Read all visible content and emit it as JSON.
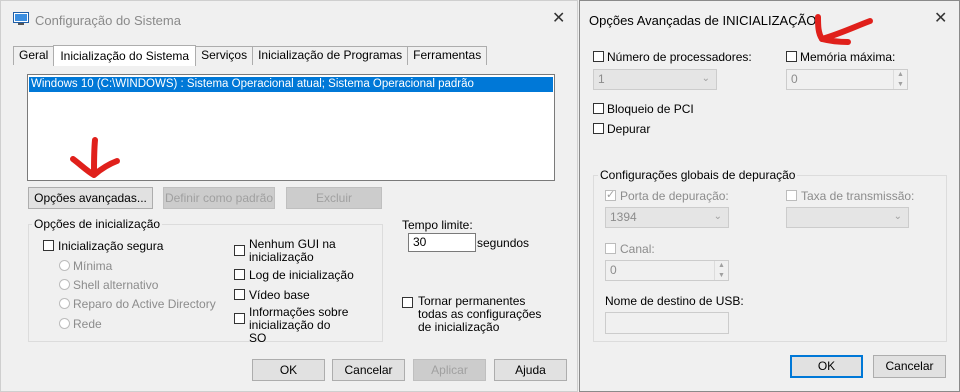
{
  "left_window": {
    "title": "Configuração do Sistema",
    "tabs": [
      "Geral",
      "Inicialização do Sistema",
      "Serviços",
      "Inicialização de Programas",
      "Ferramentas"
    ],
    "os_entries": [
      "Windows 10 (C:\\WINDOWS) : Sistema Operacional atual; Sistema Operacional padrão"
    ],
    "buttons": {
      "advanced": "Opções avançadas...",
      "set_default": "Definir como padrão",
      "delete": "Excluir"
    },
    "boot_options": {
      "label": "Opções de inicialização",
      "safe_boot": "Inicialização segura",
      "minimal": "Mínima",
      "alt_shell": "Shell alternativo",
      "ad_repair": "Reparo do Active Directory",
      "network": "Rede",
      "no_gui": "Nenhum GUI na inicialização",
      "boot_log": "Log de inicialização",
      "base_video": "Vídeo base",
      "os_boot_info": "Informações sobre inicialização do SO"
    },
    "timeout": {
      "label": "Tempo limite:",
      "value": "30",
      "unit": "segundos"
    },
    "make_permanent": "Tornar permanentes todas as configurações de inicialização",
    "footer": {
      "ok": "OK",
      "cancel": "Cancelar",
      "apply": "Aplicar",
      "help": "Ajuda"
    }
  },
  "right_window": {
    "title": "Opções Avançadas de INICIALIZAÇÃO",
    "num_processors": {
      "label": "Número de processadores:",
      "value": "1"
    },
    "max_memory": {
      "label": "Memória máxima:",
      "value": "0"
    },
    "pci_lock": "Bloqueio de PCI",
    "debug": "Depurar",
    "global_debug": {
      "label": "Configurações globais de depuração",
      "debug_port": {
        "label": "Porta de depuração:",
        "value": "1394"
      },
      "baud_rate": {
        "label": "Taxa de transmissão:",
        "value": ""
      },
      "channel": {
        "label": "Canal:",
        "value": "0"
      },
      "usb_target": {
        "label": "Nome de destino de USB:",
        "value": ""
      }
    },
    "footer": {
      "ok": "OK",
      "cancel": "Cancelar"
    }
  },
  "colors": {
    "selection": "#0078d7",
    "annotation_arrow": "#e0201b"
  }
}
